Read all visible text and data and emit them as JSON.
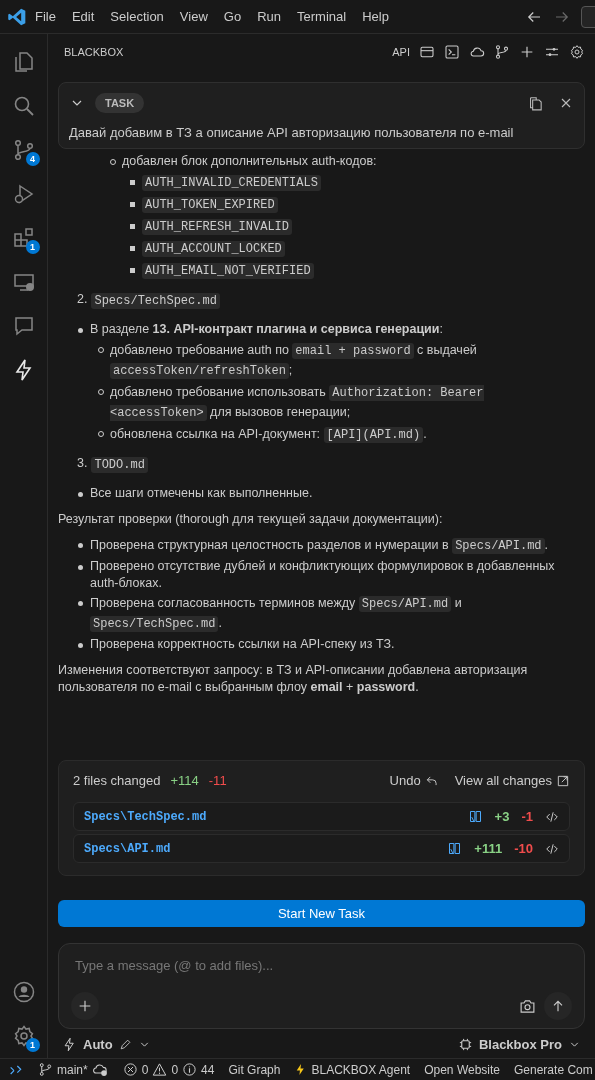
{
  "menu": [
    "File",
    "Edit",
    "Selection",
    "View",
    "Go",
    "Run",
    "Terminal",
    "Help"
  ],
  "activity_bar": [
    {
      "kind": "files",
      "selected": false
    },
    {
      "kind": "search",
      "selected": false
    },
    {
      "kind": "source-control",
      "selected": false,
      "badge": "4"
    },
    {
      "kind": "run",
      "selected": false
    },
    {
      "kind": "extensions",
      "selected": false,
      "badge": "1"
    },
    {
      "kind": "remote",
      "selected": false
    },
    {
      "kind": "chat",
      "selected": false
    },
    {
      "kind": "bolt",
      "selected": true
    }
  ],
  "activity_bottom": [
    {
      "kind": "account"
    },
    {
      "kind": "settings",
      "badge": "1"
    }
  ],
  "panel": {
    "title": "BLACKBOX",
    "api_label": "API"
  },
  "task": {
    "label": "TASK",
    "text": "Давай добавим в ТЗ а описание API авторизацию пользователя по e-mail"
  },
  "content": [
    {
      "kind": "sublist",
      "items": [
        {
          "parts": [
            {
              "kind": "text",
              "text": "добавлен блок дополнительных auth-кодов:"
            }
          ],
          "children": [
            {
              "parts": [
                {
                  "kind": "code",
                  "text": "AUTH_INVALID_CREDENTIALS"
                }
              ]
            },
            {
              "parts": [
                {
                  "kind": "code",
                  "text": "AUTH_TOKEN_EXPIRED"
                }
              ]
            },
            {
              "parts": [
                {
                  "kind": "code",
                  "text": "AUTH_REFRESH_INVALID"
                }
              ]
            },
            {
              "parts": [
                {
                  "kind": "code",
                  "text": "AUTH_ACCOUNT_LOCKED"
                }
              ]
            },
            {
              "parts": [
                {
                  "kind": "code",
                  "text": "AUTH_EMAIL_NOT_VERIFIED"
                }
              ]
            }
          ]
        }
      ]
    },
    {
      "kind": "numbered",
      "number": "2.",
      "parts": [
        {
          "kind": "code",
          "text": "Specs/TechSpec.md"
        }
      ]
    },
    {
      "kind": "list",
      "items": [
        {
          "parts": [
            {
              "kind": "text",
              "text": "В разделе **13. API-контракт плагина и сервиса генерации**:"
            }
          ],
          "children": [
            {
              "parts": [
                {
                  "kind": "text",
                  "text": "добавлено требование auth по "
                },
                {
                  "kind": "code",
                  "text": "email + password"
                },
                {
                  "kind": "text",
                  "text": " с выдачей "
                },
                {
                  "kind": "code",
                  "text": "accessToken/refreshToken"
                },
                {
                  "kind": "text",
                  "text": ";"
                }
              ]
            },
            {
              "parts": [
                {
                  "kind": "text",
                  "text": "добавлено требование использовать "
                },
                {
                  "kind": "code",
                  "text": "Authorization: Bearer <accessToken>"
                },
                {
                  "kind": "text",
                  "text": " для вызовов генерации;"
                }
              ]
            },
            {
              "parts": [
                {
                  "kind": "text",
                  "text": "обновлена ссылка на API-документ: "
                },
                {
                  "kind": "code",
                  "text": "[API](API.md)"
                },
                {
                  "kind": "text",
                  "text": "."
                }
              ]
            }
          ]
        }
      ]
    },
    {
      "kind": "numbered",
      "number": "3.",
      "parts": [
        {
          "kind": "code",
          "text": "TODO.md"
        }
      ]
    },
    {
      "kind": "list",
      "items": [
        {
          "parts": [
            {
              "kind": "text",
              "text": "Все шаги отмечены как выполненные."
            }
          ]
        }
      ]
    },
    {
      "kind": "paragraph",
      "parts": [
        {
          "kind": "text",
          "text": "Результат проверки (thorough для текущей задачи документации):"
        }
      ]
    },
    {
      "kind": "list",
      "items": [
        {
          "parts": [
            {
              "kind": "text",
              "text": "Проверена структурная целостность разделов и нумерации в "
            },
            {
              "kind": "code",
              "text": "Specs/API.md"
            },
            {
              "kind": "text",
              "text": "."
            }
          ]
        },
        {
          "parts": [
            {
              "kind": "text",
              "text": "Проверено отсутствие дублей и конфликтующих формулировок в добавленных auth-блоках."
            }
          ]
        },
        {
          "parts": [
            {
              "kind": "text",
              "text": "Проверена согласованность терминов между "
            },
            {
              "kind": "code",
              "text": "Specs/API.md"
            },
            {
              "kind": "text",
              "text": " и "
            },
            {
              "kind": "code",
              "text": "Specs/TechSpec.md"
            },
            {
              "kind": "text",
              "text": "."
            }
          ]
        },
        {
          "parts": [
            {
              "kind": "text",
              "text": "Проверена корректность ссылки на API-спеку из ТЗ."
            }
          ]
        }
      ]
    },
    {
      "kind": "paragraph",
      "parts": [
        {
          "kind": "text",
          "text": "Изменения соответствуют запросу: в ТЗ и API-описании добавлена авторизация пользователя по e-mail с выбранным флоу **email** + **password**."
        }
      ]
    }
  ],
  "changes": {
    "summary": "2 files changed",
    "added": "+114",
    "removed": "-11",
    "undo": "Undo",
    "view_all": "View all changes",
    "files": [
      {
        "path": "Specs\\TechSpec.md",
        "added": "+3",
        "removed": "-1"
      },
      {
        "path": "Specs\\API.md",
        "added": "+111",
        "removed": "-10"
      }
    ]
  },
  "start_button": "Start New Task",
  "input": {
    "placeholder": "Type a message (@ to add files)..."
  },
  "mode": "Auto",
  "model": "Blackbox Pro",
  "status_bar": {
    "branch": "main*",
    "errors": "0",
    "warnings": "0",
    "info": "44",
    "items": [
      "Git Graph",
      "BLACKBOX Agent",
      "Open Website",
      "Generate Com"
    ]
  }
}
